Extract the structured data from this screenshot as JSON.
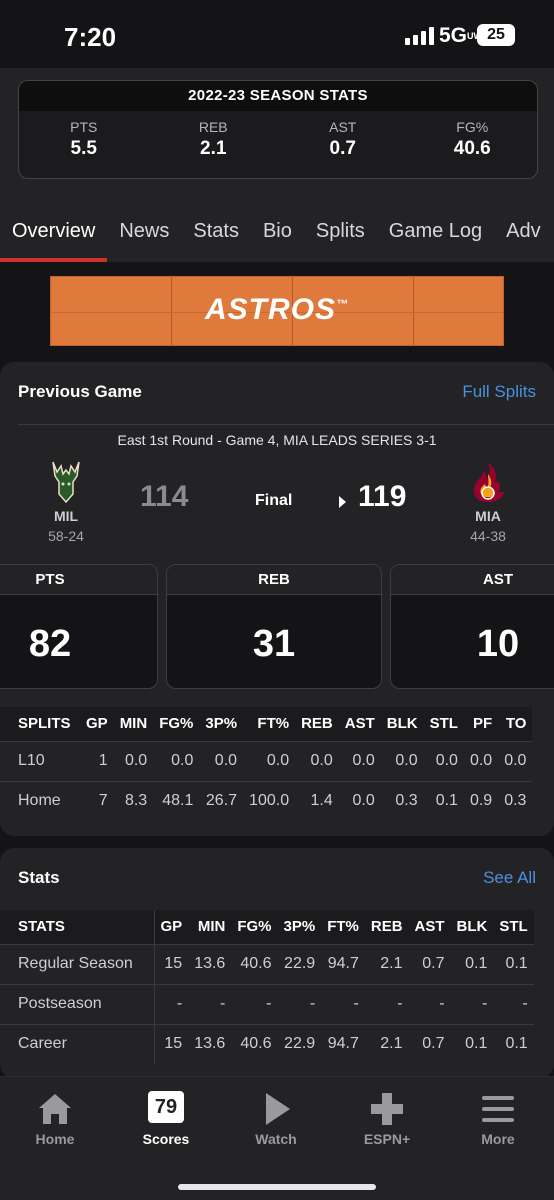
{
  "status_bar": {
    "time": "7:20",
    "network": "5G",
    "network_sub": "UW",
    "battery": "25"
  },
  "season_stats": {
    "title": "2022-23 SEASON STATS",
    "items": [
      {
        "label": "PTS",
        "value": "5.5"
      },
      {
        "label": "REB",
        "value": "2.1"
      },
      {
        "label": "AST",
        "value": "0.7"
      },
      {
        "label": "FG%",
        "value": "40.6"
      }
    ]
  },
  "tabs": [
    "Overview",
    "News",
    "Stats",
    "Bio",
    "Splits",
    "Game Log",
    "Adv"
  ],
  "ad": {
    "brand": "ASTROS",
    "mark": "™"
  },
  "previous_game": {
    "title": "Previous Game",
    "link": "Full Splits",
    "round": "East 1st Round - Game 4, MIA LEADS SERIES 3-1",
    "away": {
      "abbr": "MIL",
      "record": "58-24",
      "score": "114"
    },
    "home": {
      "abbr": "MIA",
      "record": "44-38",
      "score": "119"
    },
    "status": "Final",
    "boxes": [
      {
        "label": "PTS",
        "value": "82"
      },
      {
        "label": "REB",
        "value": "31"
      },
      {
        "label": "AST",
        "value": "10"
      }
    ],
    "splits": {
      "headers": [
        "SPLITS",
        "GP",
        "MIN",
        "FG%",
        "3P%",
        "FT%",
        "REB",
        "AST",
        "BLK",
        "STL",
        "PF",
        "TO"
      ],
      "rows": [
        [
          "L10",
          "1",
          "0.0",
          "0.0",
          "0.0",
          "0.0",
          "0.0",
          "0.0",
          "0.0",
          "0.0",
          "0.0",
          "0.0"
        ],
        [
          "Home",
          "7",
          "8.3",
          "48.1",
          "26.7",
          "100.0",
          "1.4",
          "0.0",
          "0.3",
          "0.1",
          "0.9",
          "0.3"
        ]
      ]
    }
  },
  "stats": {
    "title": "Stats",
    "link": "See All",
    "headers": [
      "STATS",
      "GP",
      "MIN",
      "FG%",
      "3P%",
      "FT%",
      "REB",
      "AST",
      "BLK",
      "STL"
    ],
    "rows": [
      [
        "Regular Season",
        "15",
        "13.6",
        "40.6",
        "22.9",
        "94.7",
        "2.1",
        "0.7",
        "0.1",
        "0.1"
      ],
      [
        "Postseason",
        "-",
        "-",
        "-",
        "-",
        "-",
        "-",
        "-",
        "-",
        "-"
      ],
      [
        "Career",
        "15",
        "13.6",
        "40.6",
        "22.9",
        "94.7",
        "2.1",
        "0.7",
        "0.1",
        "0.1"
      ]
    ]
  },
  "tab_bar": [
    {
      "label": "Home",
      "icon": "home-icon"
    },
    {
      "label": "Scores",
      "icon": "scores-icon",
      "icon_text": "79"
    },
    {
      "label": "Watch",
      "icon": "play-icon"
    },
    {
      "label": "ESPN+",
      "icon": "plus-icon"
    },
    {
      "label": "More",
      "icon": "menu-icon"
    }
  ],
  "colors": {
    "accent": "#d0312d",
    "link": "#4a90e2",
    "background": "#141416",
    "card": "#232325",
    "ad": "#e07a3c"
  }
}
